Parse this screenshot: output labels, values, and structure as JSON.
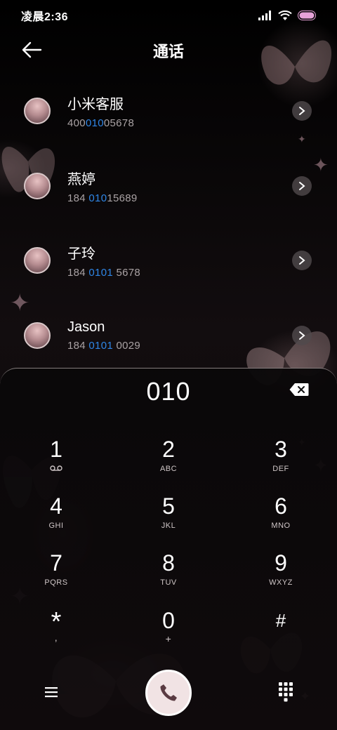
{
  "status_bar": {
    "time": "凌晨2:36"
  },
  "header": {
    "title": "通话"
  },
  "contacts": [
    {
      "name": "小米客服",
      "number_pre": "400",
      "number_hl": "010",
      "number_post": "05678"
    },
    {
      "name": "燕婷",
      "number_pre": "184 ",
      "number_hl": "010",
      "number_post": "15689"
    },
    {
      "name": "子玲",
      "number_pre": "184 ",
      "number_hl": "0101",
      "number_post": " 5678"
    },
    {
      "name": "Jason",
      "number_pre": "184 ",
      "number_hl": "0101",
      "number_post": " 0029"
    }
  ],
  "dialer": {
    "input": "010",
    "keys": [
      {
        "digit": "1",
        "letters": ""
      },
      {
        "digit": "2",
        "letters": "ABC"
      },
      {
        "digit": "3",
        "letters": "DEF"
      },
      {
        "digit": "4",
        "letters": "GHI"
      },
      {
        "digit": "5",
        "letters": "JKL"
      },
      {
        "digit": "6",
        "letters": "MNO"
      },
      {
        "digit": "7",
        "letters": "PQRS"
      },
      {
        "digit": "8",
        "letters": "TUV"
      },
      {
        "digit": "9",
        "letters": "WXYZ"
      },
      {
        "digit": "*",
        "letters": ","
      },
      {
        "digit": "0",
        "letters": "+"
      },
      {
        "digit": "#",
        "letters": ""
      }
    ]
  },
  "colors": {
    "highlight": "#2f86e6",
    "accent": "#f1e3e4"
  }
}
